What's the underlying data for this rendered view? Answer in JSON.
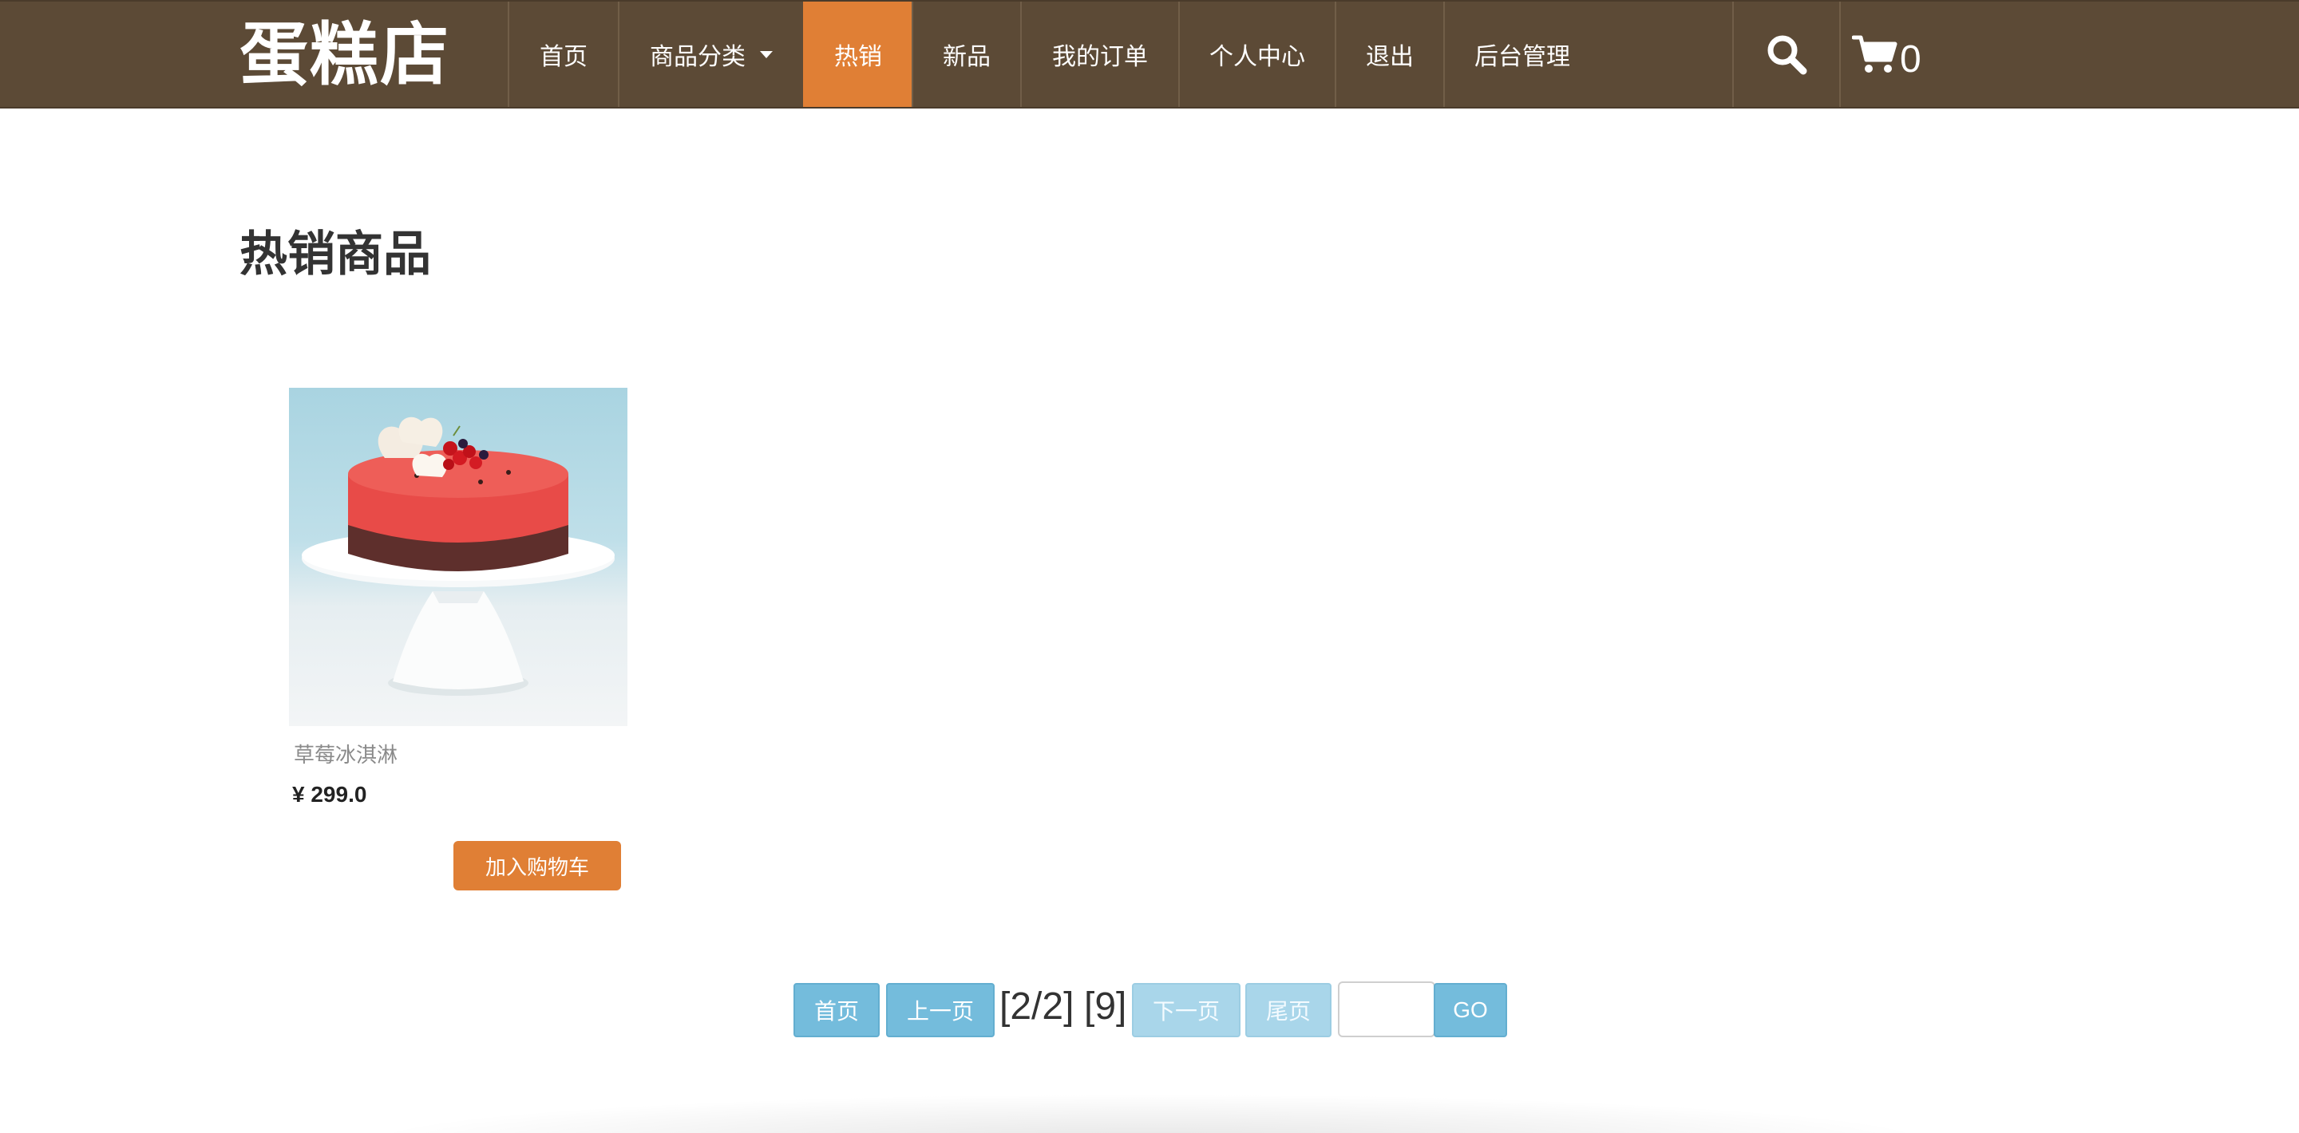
{
  "header": {
    "logo": "蛋糕店",
    "nav": [
      {
        "label": "首页",
        "active": false
      },
      {
        "label": "商品分类",
        "active": false,
        "dropdown": true
      },
      {
        "label": "热销",
        "active": true
      },
      {
        "label": "新品",
        "active": false
      },
      {
        "label": "我的订单",
        "active": false
      },
      {
        "label": "个人中心",
        "active": false
      },
      {
        "label": "退出",
        "active": false
      },
      {
        "label": "后台管理",
        "active": false
      }
    ],
    "search_icon": "search-icon",
    "cart_icon": "cart-icon",
    "cart_count": "0"
  },
  "main": {
    "title": "热销商品",
    "products": [
      {
        "name": "草莓冰淇淋",
        "price": "¥ 299.0",
        "add_to_cart": "加入购物车",
        "image": "red-mousse-cake-on-white-stand"
      }
    ]
  },
  "pagination": {
    "first": "首页",
    "prev": "上一页",
    "page_info": "[2/2]",
    "total": "[9]",
    "next": "下一页",
    "last": "尾页",
    "jump_value": "",
    "go": "GO"
  },
  "colors": {
    "header_bg": "#5c4a36",
    "accent": "#e07f35",
    "pager_button": "#74bcdc"
  }
}
